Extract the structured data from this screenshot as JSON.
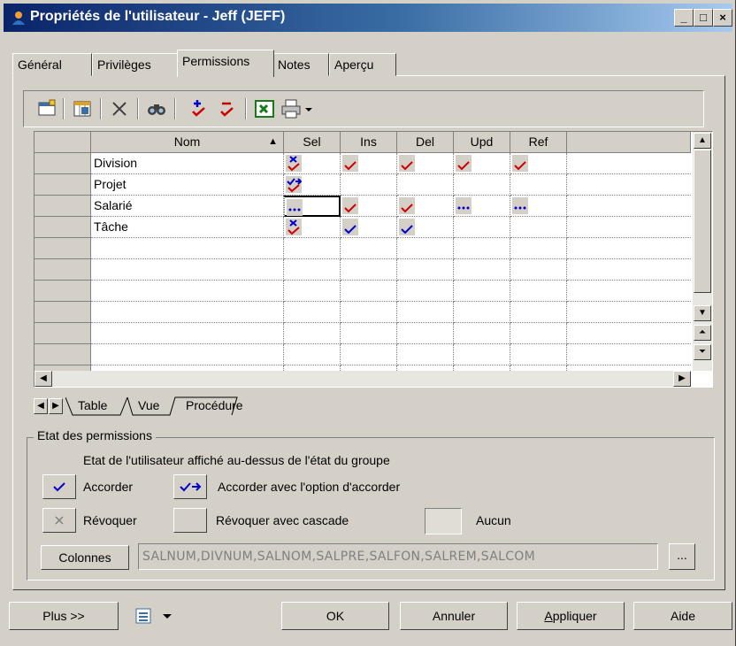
{
  "window": {
    "title": "Propriétés de l'utilisateur - Jeff (JEFF)",
    "minimize": "_",
    "maximize": "□",
    "close": "×"
  },
  "tabs": [
    "Général",
    "Privilèges",
    "Permissions",
    "Notes",
    "Aperçu"
  ],
  "active_tab": "Permissions",
  "toolbar_icons": [
    "properties-icon",
    "add-columns-icon",
    "delete-icon",
    "find-icon",
    "grant-icon",
    "revoke-icon",
    "excel-export-icon",
    "print-icon",
    "dropdown-arrow-icon"
  ],
  "grid": {
    "columns": [
      "Nom",
      "Sel",
      "Ins",
      "Del",
      "Upd",
      "Ref"
    ],
    "sort_indicator": "▲",
    "rows": [
      {
        "name": "Division",
        "perms": {
          "Sel": "revoke-grant",
          "Ins": "grant",
          "Del": "grant",
          "Upd": "grant",
          "Ref": "grant"
        }
      },
      {
        "name": "Projet",
        "perms": {
          "Sel": "grant-option-grant"
        }
      },
      {
        "name": "Salarié",
        "perms": {
          "Sel": "inherit",
          "Ins": "grant",
          "Del": "grant",
          "Upd": "inherit",
          "Ref": "inherit"
        }
      },
      {
        "name": "Tâche",
        "perms": {
          "Sel": "revoke-grant",
          "Ins": "grant-blue",
          "Del": "grant-blue"
        }
      }
    ],
    "empty_rows": 7
  },
  "sheet_tabs": [
    "Table",
    "Vue",
    "Procédure"
  ],
  "legend": {
    "group_title": "Etat des permissions",
    "note": "Etat de l'utilisateur affiché au-dessus de l'état du groupe",
    "grant": "Accorder",
    "grant_with_option": "Accorder avec l'option d'accorder",
    "revoke": "Révoquer",
    "revoke_cascade": "Révoquer avec cascade",
    "none": "Aucun"
  },
  "columns_button": "Colonnes",
  "columns_value": "SALNUM,DIVNUM,SALNOM,SALPRE,SALFON,SALREM,SALCOM",
  "ellipsis_button": "...",
  "footer": {
    "more": "Plus >>",
    "ok": "OK",
    "cancel": "Annuler",
    "apply": "Appliquer",
    "apply_mnemonic": "A",
    "apply_rest": "ppliquer",
    "help": "Aide"
  },
  "colors": {
    "grant_red": "#cc0000",
    "grant_blue": "#0000cc",
    "title_start": "#0a246a",
    "title_end": "#a6caf0",
    "face": "#d4d0c8"
  }
}
